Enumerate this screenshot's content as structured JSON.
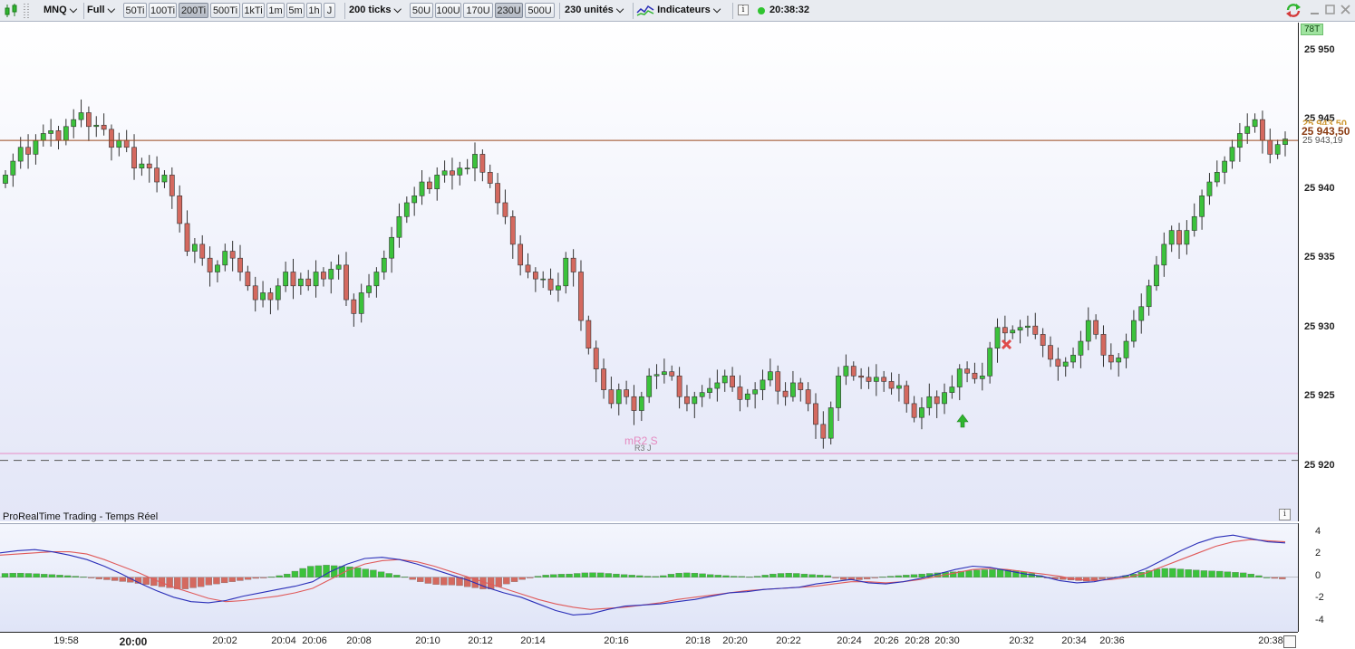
{
  "toolbar": {
    "symbol": "MNQ",
    "mode": "Full",
    "timeframes": [
      {
        "label": "50Ti",
        "active": false
      },
      {
        "label": "100Ti",
        "active": false
      },
      {
        "label": "200Ti",
        "active": true
      },
      {
        "label": "500Ti",
        "active": false
      },
      {
        "label": "1kTi",
        "active": false
      },
      {
        "label": "1m",
        "active": false
      },
      {
        "label": "5m",
        "active": false
      },
      {
        "label": "1h",
        "active": false
      },
      {
        "label": "J",
        "active": false
      }
    ],
    "ticks_label": "200 ticks",
    "units": [
      {
        "label": "50U",
        "active": false
      },
      {
        "label": "100U",
        "active": false
      },
      {
        "label": "170U",
        "active": false
      },
      {
        "label": "230U",
        "active": true
      },
      {
        "label": "500U",
        "active": false
      }
    ],
    "units_label": "230 unités",
    "indicators_label": "Indicateurs",
    "clock": "20:38:32"
  },
  "chart": {
    "provider_label": "ProRealTime Trading - Temps Réel",
    "level_label_1": "mR2 S",
    "level_label_2": "R3 J",
    "badge": "78T",
    "current_price": "25 943,50",
    "secondary_price": "25 943,19",
    "hidden_price": "25 943,50",
    "price_ticks": [
      "25 950",
      "25 945",
      "25 940",
      "25 935",
      "25 930",
      "25 925",
      "25 920"
    ],
    "osc_ticks": [
      "4",
      "2",
      "0",
      "-2",
      "-4"
    ],
    "time_ticks": [
      {
        "label": "19:58",
        "bold": false
      },
      {
        "label": "20:00",
        "bold": true
      },
      {
        "label": "20:02",
        "bold": false
      },
      {
        "label": "20:04",
        "bold": false
      },
      {
        "label": "20:06",
        "bold": false
      },
      {
        "label": "20:08",
        "bold": false
      },
      {
        "label": "20:10",
        "bold": false
      },
      {
        "label": "20:12",
        "bold": false
      },
      {
        "label": "20:14",
        "bold": false
      },
      {
        "label": "20:16",
        "bold": false
      },
      {
        "label": "20:18",
        "bold": false
      },
      {
        "label": "20:20",
        "bold": false
      },
      {
        "label": "20:22",
        "bold": false
      },
      {
        "label": "20:24",
        "bold": false
      },
      {
        "label": "20:26",
        "bold": false
      },
      {
        "label": "20:28",
        "bold": false
      },
      {
        "label": "20:30",
        "bold": false
      },
      {
        "label": "20:32",
        "bold": false
      },
      {
        "label": "20:34",
        "bold": false
      },
      {
        "label": "20:36",
        "bold": false
      },
      {
        "label": "20:38",
        "bold": false
      }
    ],
    "colors": {
      "up": "#3bc23b",
      "down": "#d4695f",
      "price_line": "#9a4a1e",
      "level_line": "#e88ac6",
      "macd": "#2b2fb8",
      "signal": "#e05a5a"
    }
  },
  "chart_data": {
    "type": "candlestick",
    "ylim": [
      25916,
      25952
    ],
    "y_step": 5,
    "current_price": 25943.5,
    "levels": [
      {
        "label": "mR2 S",
        "value": 25920.9
      },
      {
        "label": "R3 J",
        "value": 25920.4
      }
    ],
    "closes": [
      25941,
      25942,
      25943,
      25942.5,
      25943.5,
      25944,
      25944.2,
      25943.5,
      25944.5,
      25945,
      25945.5,
      25944.5,
      25944.6,
      25944.3,
      25943,
      25943.5,
      25943,
      25941.5,
      25941.8,
      25941.5,
      25940.5,
      25941,
      25939.5,
      25937.5,
      25935.5,
      25936,
      25935,
      25934,
      25934.5,
      25935.5,
      25935,
      25934,
      25933,
      25932,
      25932.5,
      25932,
      25933,
      25934,
      25933,
      25933.5,
      25933,
      25934,
      25933.5,
      25934.2,
      25934.5,
      25932,
      25931,
      25932.5,
      25933,
      25934,
      25935,
      25936.5,
      25938,
      25939,
      25939.5,
      25940.5,
      25940,
      25941,
      25941.3,
      25941,
      25941.5,
      25941.5,
      25942.5,
      25941.2,
      25940.4,
      25939,
      25938,
      25936,
      25934.5,
      25934,
      25933.5,
      25933.5,
      25932.7,
      25933,
      25935,
      25934,
      25930.5,
      25928.5,
      25927,
      25925.5,
      25924.5,
      25925.5,
      25925,
      25924,
      25925,
      25926.5,
      25926.6,
      25926.8,
      25926.5,
      25925,
      25924.5,
      25925,
      25925.3,
      25925.6,
      25926,
      25926.5,
      25925.7,
      25924.8,
      25925.2,
      25925.5,
      25926.2,
      25926.8,
      25925.4,
      25925,
      25926,
      25925.5,
      25924.5,
      25923,
      25922,
      25924.2,
      25926.5,
      25927.2,
      25926.5,
      25926.4,
      25926.1,
      25926.4,
      25926.1,
      25925.6,
      25925.8,
      25924.5,
      25923.5,
      25924.2,
      25925,
      25924.5,
      25925.3,
      25925.7,
      25927,
      25926.7,
      25926.3,
      25926.5,
      25928.5,
      25930,
      25929.6,
      25929.8,
      25930,
      25930.1,
      25929.5,
      25928.7,
      25927.7,
      25927.2,
      25927.5,
      25928,
      25929,
      25930.5,
      25929.5,
      25928,
      25927.5,
      25927.8,
      25929,
      25930.5,
      25931.5,
      25933,
      25934.5,
      25936,
      25937,
      25936,
      25937,
      25938,
      25939.5,
      25940.5,
      25941.2,
      25942,
      25943,
      25944,
      25944.5,
      25945,
      25943.5,
      25942.5,
      25943.2,
      25943.6
    ],
    "oscillator": {
      "histogram": [
        0.35,
        0.38,
        0.38,
        0.35,
        0.32,
        0.28,
        0.25,
        0.2,
        0.15,
        0.1,
        0.05,
        -0.05,
        -0.15,
        -0.22,
        -0.3,
        -0.38,
        -0.45,
        -0.55,
        -0.65,
        -0.75,
        -0.85,
        -0.95,
        -1.05,
        -1.05,
        -0.95,
        -0.85,
        -0.7,
        -0.6,
        -0.5,
        -0.4,
        -0.3,
        -0.2,
        -0.1,
        -0.05,
        0.05,
        0.15,
        0.3,
        0.55,
        0.8,
        1.0,
        1.05,
        1.1,
        1.05,
        1.0,
        0.95,
        0.85,
        0.75,
        0.65,
        0.5,
        0.35,
        0.2,
        0.05,
        -0.2,
        -0.4,
        -0.55,
        -0.65,
        -0.7,
        -0.7,
        -0.75,
        -0.85,
        -0.95,
        -1.05,
        -1.05,
        -0.85,
        -0.6,
        -0.4,
        -0.2,
        -0.05,
        0.1,
        0.2,
        0.25,
        0.28,
        0.3,
        0.35,
        0.4,
        0.42,
        0.4,
        0.35,
        0.3,
        0.25,
        0.2,
        0.15,
        0.1,
        0.08,
        0.15,
        0.28,
        0.38,
        0.4,
        0.38,
        0.32,
        0.25,
        0.2,
        0.15,
        0.1,
        0.08,
        0.05,
        0.1,
        0.2,
        0.3,
        0.35,
        0.38,
        0.35,
        0.3,
        0.25,
        0.2,
        0.15,
        -0.05,
        -0.2,
        -0.25,
        -0.22,
        -0.15,
        -0.05,
        0.05,
        0.1,
        0.15,
        0.2,
        0.25,
        0.3,
        0.35,
        0.4,
        0.45,
        0.5,
        0.55,
        0.6,
        0.65,
        0.68,
        0.7,
        0.7,
        0.68,
        0.6,
        0.5,
        0.35,
        0.15,
        -0.05,
        -0.15,
        -0.2,
        -0.25,
        -0.3,
        -0.35,
        -0.25,
        -0.15,
        -0.05,
        0.05,
        0.15,
        0.3,
        0.45,
        0.6,
        0.75,
        0.8,
        0.8,
        0.75,
        0.7,
        0.65,
        0.6,
        0.58,
        0.55,
        0.5,
        0.45,
        0.4,
        0.3,
        0.15,
        0.0,
        -0.1,
        -0.15
      ],
      "macd": [
        2.2,
        2.4,
        2.5,
        2.3,
        2.0,
        1.6,
        1.0,
        0.3,
        -0.5,
        -1.2,
        -1.8,
        -2.2,
        -2.3,
        -2.1,
        -1.7,
        -1.4,
        -1.1,
        -0.8,
        -0.4,
        0.5,
        1.2,
        1.7,
        1.8,
        1.6,
        1.2,
        0.7,
        0.2,
        -0.3,
        -0.9,
        -1.4,
        -1.8,
        -2.4,
        -3.0,
        -3.4,
        -3.3,
        -2.9,
        -2.6,
        -2.5,
        -2.4,
        -2.2,
        -2.0,
        -1.7,
        -1.4,
        -1.3,
        -1.1,
        -1.0,
        -0.9,
        -0.6,
        -0.4,
        -0.2,
        -0.5,
        -0.6,
        -0.4,
        -0.1,
        0.3,
        0.7,
        1.0,
        0.9,
        0.6,
        0.3,
        0.1,
        -0.3,
        -0.5,
        -0.4,
        -0.1,
        0.2,
        0.8,
        1.6,
        2.4,
        3.1,
        3.6,
        3.8,
        3.5,
        3.2,
        3.1
      ],
      "signal": [
        2.0,
        2.1,
        2.2,
        2.3,
        2.3,
        2.1,
        1.6,
        1.0,
        0.4,
        -0.3,
        -0.9,
        -1.4,
        -1.9,
        -2.2,
        -2.1,
        -1.9,
        -1.7,
        -1.4,
        -1.0,
        -0.2,
        0.6,
        1.2,
        1.5,
        1.6,
        1.4,
        1.0,
        0.5,
        0.0,
        -0.5,
        -1.0,
        -1.5,
        -2.0,
        -2.4,
        -2.7,
        -2.9,
        -2.8,
        -2.7,
        -2.5,
        -2.3,
        -2.0,
        -1.8,
        -1.6,
        -1.4,
        -1.2,
        -1.1,
        -1.0,
        -0.9,
        -0.8,
        -0.6,
        -0.4,
        -0.4,
        -0.5,
        -0.4,
        -0.2,
        0.1,
        0.4,
        0.7,
        0.8,
        0.7,
        0.5,
        0.3,
        0.1,
        -0.2,
        -0.3,
        -0.2,
        0.0,
        0.4,
        1.0,
        1.6,
        2.2,
        2.8,
        3.2,
        3.4,
        3.3,
        3.2
      ],
      "ylim": [
        -5,
        4.8
      ]
    }
  }
}
